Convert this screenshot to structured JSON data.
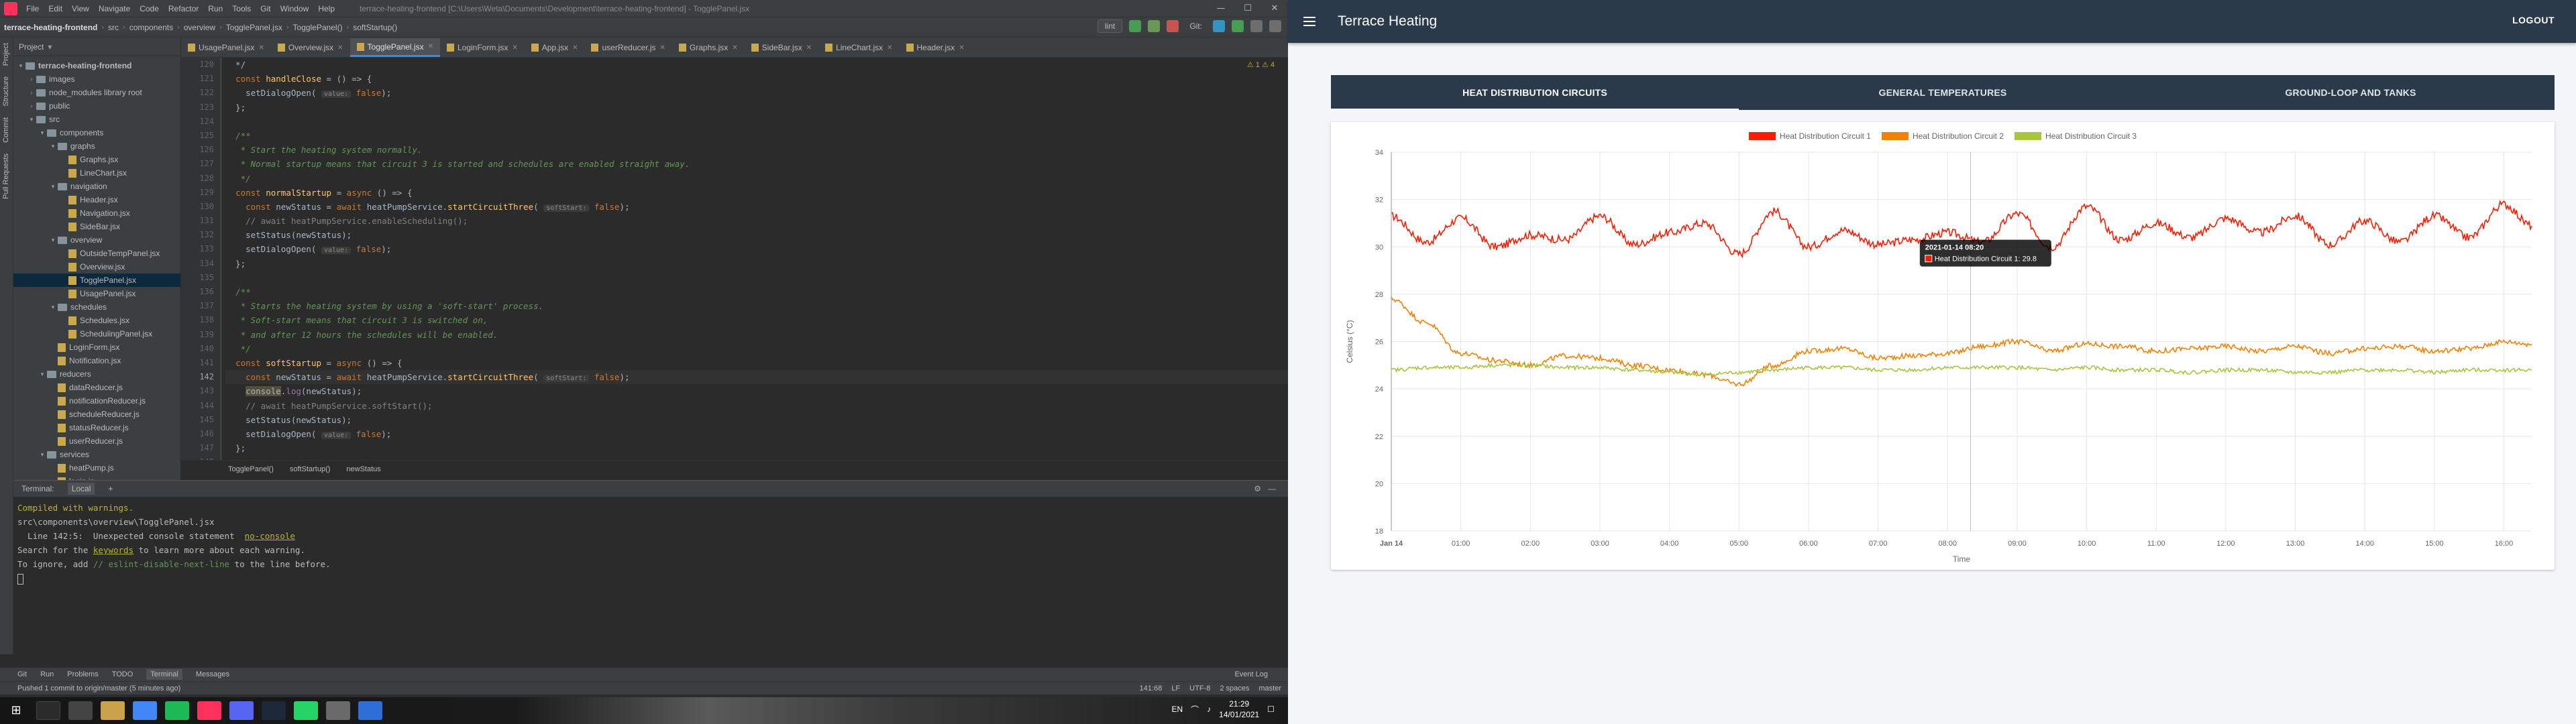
{
  "ide": {
    "window_title": "terrace-heating-frontend [C:\\Users\\Weta\\Documents\\Development\\terrace-heating-frontend] - TogglePanel.jsx",
    "menu": [
      "File",
      "Edit",
      "View",
      "Navigate",
      "Code",
      "Refactor",
      "Run",
      "Tools",
      "Git",
      "Window",
      "Help"
    ],
    "breadcrumbs": [
      "terrace-heating-frontend",
      "src",
      "components",
      "overview",
      "TogglePanel.jsx",
      "TogglePanel()",
      "softStartup()"
    ],
    "run_config": "lint",
    "git_label": "Git:",
    "project_header": "Project",
    "tree": [
      {
        "label": "terrace-heating-frontend",
        "depth": 0,
        "type": "folder",
        "arrow": "▾"
      },
      {
        "label": "images",
        "depth": 1,
        "type": "folder",
        "arrow": "›"
      },
      {
        "label": "node_modules  library root",
        "depth": 1,
        "type": "folder",
        "arrow": "›"
      },
      {
        "label": "public",
        "depth": 1,
        "type": "folder",
        "arrow": "›"
      },
      {
        "label": "src",
        "depth": 1,
        "type": "folder",
        "arrow": "▾"
      },
      {
        "label": "components",
        "depth": 2,
        "type": "folder",
        "arrow": "▾"
      },
      {
        "label": "graphs",
        "depth": 3,
        "type": "folder",
        "arrow": "▾"
      },
      {
        "label": "Graphs.jsx",
        "depth": 4,
        "type": "file",
        "arrow": ""
      },
      {
        "label": "LineChart.jsx",
        "depth": 4,
        "type": "file",
        "arrow": ""
      },
      {
        "label": "navigation",
        "depth": 3,
        "type": "folder",
        "arrow": "▾"
      },
      {
        "label": "Header.jsx",
        "depth": 4,
        "type": "file",
        "arrow": ""
      },
      {
        "label": "Navigation.jsx",
        "depth": 4,
        "type": "file",
        "arrow": ""
      },
      {
        "label": "SideBar.jsx",
        "depth": 4,
        "type": "file",
        "arrow": ""
      },
      {
        "label": "overview",
        "depth": 3,
        "type": "folder",
        "arrow": "▾"
      },
      {
        "label": "OutsideTempPanel.jsx",
        "depth": 4,
        "type": "file",
        "arrow": ""
      },
      {
        "label": "Overview.jsx",
        "depth": 4,
        "type": "file",
        "arrow": ""
      },
      {
        "label": "TogglePanel.jsx",
        "depth": 4,
        "type": "file",
        "arrow": "",
        "selected": true
      },
      {
        "label": "UsagePanel.jsx",
        "depth": 4,
        "type": "file",
        "arrow": ""
      },
      {
        "label": "schedules",
        "depth": 3,
        "type": "folder",
        "arrow": "▾"
      },
      {
        "label": "Schedules.jsx",
        "depth": 4,
        "type": "file",
        "arrow": ""
      },
      {
        "label": "SchedulingPanel.jsx",
        "depth": 4,
        "type": "file",
        "arrow": ""
      },
      {
        "label": "LoginForm.jsx",
        "depth": 3,
        "type": "file",
        "arrow": ""
      },
      {
        "label": "Notification.jsx",
        "depth": 3,
        "type": "file",
        "arrow": ""
      },
      {
        "label": "reducers",
        "depth": 2,
        "type": "folder",
        "arrow": "▾"
      },
      {
        "label": "dataReducer.js",
        "depth": 3,
        "type": "file",
        "arrow": ""
      },
      {
        "label": "notificationReducer.js",
        "depth": 3,
        "type": "file",
        "arrow": ""
      },
      {
        "label": "scheduleReducer.js",
        "depth": 3,
        "type": "file",
        "arrow": ""
      },
      {
        "label": "statusReducer.js",
        "depth": 3,
        "type": "file",
        "arrow": ""
      },
      {
        "label": "userReducer.js",
        "depth": 3,
        "type": "file",
        "arrow": ""
      },
      {
        "label": "services",
        "depth": 2,
        "type": "folder",
        "arrow": "▾"
      },
      {
        "label": "heatPump.js",
        "depth": 3,
        "type": "file",
        "arrow": ""
      },
      {
        "label": "login.js",
        "depth": 3,
        "type": "file",
        "arrow": ""
      }
    ],
    "tabs": [
      {
        "label": "UsagePanel.jsx",
        "active": false
      },
      {
        "label": "Overview.jsx",
        "active": false
      },
      {
        "label": "TogglePanel.jsx",
        "active": true
      },
      {
        "label": "LoginForm.jsx",
        "active": false
      },
      {
        "label": "App.jsx",
        "active": false
      },
      {
        "label": "userReducer.js",
        "active": false
      },
      {
        "label": "Graphs.jsx",
        "active": false
      },
      {
        "label": "SideBar.jsx",
        "active": false
      },
      {
        "label": "LineChart.jsx",
        "active": false
      },
      {
        "label": "Header.jsx",
        "active": false
      }
    ],
    "warnings_indicator": "⚠ 1  ⚠ 4",
    "line_numbers": [
      "120",
      "121",
      "122",
      "123",
      "124",
      "125",
      "126",
      "127",
      "128",
      "129",
      "130",
      "131",
      "132",
      "133",
      "134",
      "135",
      "136",
      "137",
      "138",
      "139",
      "140",
      "141",
      "142",
      "143",
      "144",
      "145",
      "146",
      "147",
      "148"
    ],
    "code_breadcrumb": [
      "TogglePanel()",
      "softStartup()",
      "newStatus"
    ],
    "terminal": {
      "tabs": [
        "Terminal:",
        "Local",
        "+"
      ],
      "lines": [
        "Compiled with warnings.",
        "",
        "src\\components\\overview\\TogglePanel.jsx",
        "  Line 142:5:  Unexpected console statement  no-console",
        "",
        "Search for the keywords to learn more about each warning.",
        "To ignore, add // eslint-disable-next-line to the line before."
      ]
    },
    "toolstrip": [
      "Git",
      "Run",
      "Problems",
      "TODO",
      "Terminal",
      "Messages"
    ],
    "event_log": "Event Log",
    "status_left": "Pushed 1 commit to origin/master (5 minutes ago)",
    "status_right": [
      "141:68",
      "LF",
      "UTF-8",
      "2 spaces",
      "master"
    ],
    "taskbar": {
      "lang": "EN",
      "time": "21:29",
      "date": "14/01/2021"
    }
  },
  "app": {
    "title": "Terrace Heating",
    "logout": "LOGOUT",
    "tabs": [
      "HEAT DISTRIBUTION CIRCUITS",
      "GENERAL TEMPERATURES",
      "GROUND-LOOP AND TANKS"
    ],
    "tooltip_title": "2021-01-14 08:20",
    "tooltip_value": "Heat Distribution Circuit 1: 29.8"
  },
  "chart_data": {
    "type": "line",
    "title": "",
    "xlabel": "Time",
    "ylabel": "Celsius (°C)",
    "ylim": [
      18,
      34
    ],
    "yticks": [
      18,
      20,
      22,
      24,
      26,
      28,
      30,
      32,
      34
    ],
    "xlim_hours": [
      0,
      16.4
    ],
    "x_start_label": "Jan 14",
    "xticks": [
      "01:00",
      "02:00",
      "03:00",
      "04:00",
      "05:00",
      "06:00",
      "07:00",
      "08:00",
      "09:00",
      "10:00",
      "11:00",
      "12:00",
      "13:00",
      "14:00",
      "15:00",
      "16:00"
    ],
    "grid": true,
    "legend_position": "top",
    "series": [
      {
        "name": "Heat Distribution Circuit 1",
        "color": "#ff1a00",
        "x": [
          0,
          0.5,
          1,
          1.5,
          2,
          2.5,
          3,
          3.5,
          4,
          4.5,
          5,
          5.5,
          6,
          6.5,
          7,
          7.5,
          8,
          8.5,
          9,
          9.5,
          10,
          10.5,
          11,
          11.5,
          12,
          12.5,
          13,
          13.5,
          14,
          14.5,
          15,
          15.5,
          16,
          16.4
        ],
        "y": [
          31.3,
          30.2,
          31.2,
          30.0,
          30.5,
          30.3,
          31.3,
          30.1,
          30.6,
          31.0,
          29.7,
          31.5,
          30.0,
          30.7,
          30.1,
          30.3,
          30.6,
          30.2,
          31.4,
          30.0,
          31.7,
          30.3,
          31.0,
          30.4,
          31.2,
          30.6,
          31.3,
          30.1,
          31.1,
          30.2,
          31.3,
          30.4,
          31.8,
          30.9
        ]
      },
      {
        "name": "Heat Distribution Circuit 2",
        "color": "#f78000",
        "x": [
          0,
          0.5,
          1,
          1.5,
          2,
          2.5,
          3,
          3.5,
          4,
          4.5,
          5,
          5.5,
          6,
          6.5,
          7,
          7.5,
          8,
          8.5,
          9,
          9.5,
          10,
          10.5,
          11,
          11.5,
          12,
          12.5,
          13,
          13.5,
          14,
          14.5,
          15,
          15.5,
          16,
          16.4
        ],
        "y": [
          27.8,
          26.8,
          25.5,
          25.2,
          25.0,
          25.4,
          25.3,
          25.0,
          24.8,
          24.6,
          24.2,
          25.0,
          25.6,
          25.7,
          25.3,
          25.4,
          25.5,
          25.8,
          26.0,
          25.6,
          25.9,
          25.8,
          25.6,
          25.7,
          25.8,
          25.6,
          25.8,
          25.5,
          25.7,
          25.8,
          25.6,
          25.7,
          26.0,
          25.9
        ]
      },
      {
        "name": "Heat Distribution Circuit 3",
        "color": "#a8c63a",
        "x": [
          0,
          0.5,
          1,
          1.5,
          2,
          2.5,
          3,
          3.5,
          4,
          4.5,
          5,
          5.5,
          6,
          6.5,
          7,
          7.5,
          8,
          8.5,
          9,
          9.5,
          10,
          10.5,
          11,
          11.5,
          12,
          12.5,
          13,
          13.5,
          14,
          14.5,
          15,
          15.5,
          16,
          16.4
        ],
        "y": [
          24.8,
          24.9,
          24.9,
          25.0,
          25.0,
          24.9,
          24.9,
          24.8,
          24.7,
          24.6,
          24.7,
          24.8,
          24.9,
          24.9,
          24.8,
          24.8,
          24.9,
          24.9,
          24.9,
          24.8,
          24.9,
          24.8,
          24.8,
          24.7,
          24.8,
          24.8,
          24.7,
          24.7,
          24.8,
          24.8,
          24.7,
          24.8,
          24.8,
          24.8
        ]
      }
    ],
    "annotation_x": 8.33
  }
}
